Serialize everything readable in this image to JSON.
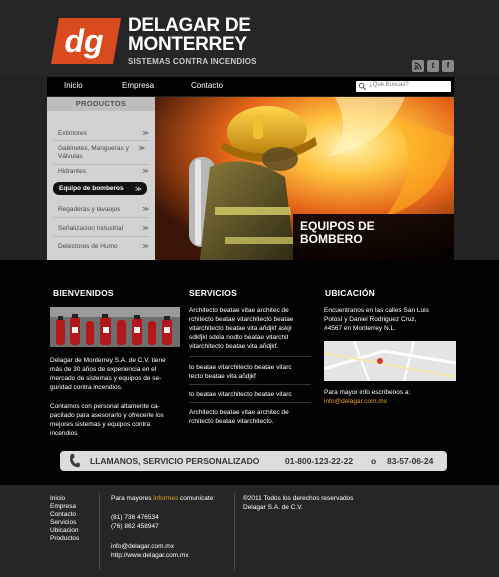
{
  "brand": {
    "logo_mark": "dg",
    "name_line1": "DELAGAR DE",
    "name_line2": "MONTERREY",
    "tagline": "SISTEMAS CONTRA INCENDIOS",
    "accent": "#d94a1e"
  },
  "social": [
    "rss-icon",
    "twitter-icon",
    "facebook-icon"
  ],
  "nav": {
    "items": [
      "Inicio",
      "Empresa",
      "Contacto"
    ],
    "search_placeholder": "¿Que Buscas?"
  },
  "sidebar": {
    "title": "PRODUCTOS",
    "items": [
      {
        "label": "Extintores"
      },
      {
        "label": "Gabinetes, Mangueras y Válvulas"
      },
      {
        "label": "Hidrantes"
      },
      {
        "label": "Equipo de bomberos",
        "active": true
      },
      {
        "label": "Regaderas y lavaojos"
      },
      {
        "label": "Señalizacion Industrial"
      },
      {
        "label": "Detectores de Humo"
      }
    ],
    "chevron": "≫"
  },
  "hero": {
    "caption_line1": "EQUIPOS DE",
    "caption_line2": "BOMBERO"
  },
  "bienvenidos": {
    "title": "BIENVENIDOS",
    "p1": [
      "Delagar de Monterrey S.A. de C.V. tiene",
      "más de 30 años de experiencia en el",
      "mercado de sistemas y equipos de se-",
      "guridad contra incendios."
    ],
    "p2": [
      "Contamos con personal altamente ca-",
      "pacitado para asesorarlo y ofrecerle los",
      "mejores sistemas y equipos contra",
      "incendios"
    ]
  },
  "servicios": {
    "title": "SERVICIOS",
    "b1": [
      "Architecto beatae vitae architec de",
      "rchitecto beatae vitarchitecto beatae",
      "vitarchitecto beatae vita añdjkf askjr",
      "sdkfjkl sdela nodto beatae vitarchit",
      "vitarchitecto beatae vita añdjkf."
    ],
    "b2": [
      "to beatae vitarchitecto beatae vitarc",
      "tecto beatae vita añdjkf"
    ],
    "b3": [
      "to beatae vitarchitecto beatae vitarc"
    ],
    "b4": [
      "Architecto beatae vitae architec de",
      "rchitecto beatae vitarchitecto."
    ]
  },
  "ubicacion": {
    "title": "UBICACIÓN",
    "address": [
      "Encuentranos en las calles San Luis",
      "Potosí y Daniel Rodriguez Cruz,",
      "#4567 en  Monterrey N.L."
    ],
    "info_text": "Para mayor info escribenos a:",
    "email": "info@delagar.com.mx"
  },
  "callbar": {
    "label": "LLAMANOS, SERVICIO PERSONALIZADO",
    "phone1": "01-800-123-22-22",
    "sep": "o",
    "phone2": "83-57-06-24"
  },
  "footer": {
    "links": [
      "Inicio",
      "Empresa",
      "Contacto",
      "Servicios",
      "Ubicacion",
      "Productos"
    ],
    "contact_prefix": "Para mayores ",
    "contact_highlight": "informes",
    "contact_suffix": " comunicate:",
    "phone1": "(81) 736 476534",
    "phone2": "(76) 862 458947",
    "email": "info@delagar.com.mx",
    "website": "http://www.delagar.com.mx",
    "copyright1": "®2011 Todos los derechos reservados",
    "copyright2": "Delagar S.A. de C.V."
  }
}
